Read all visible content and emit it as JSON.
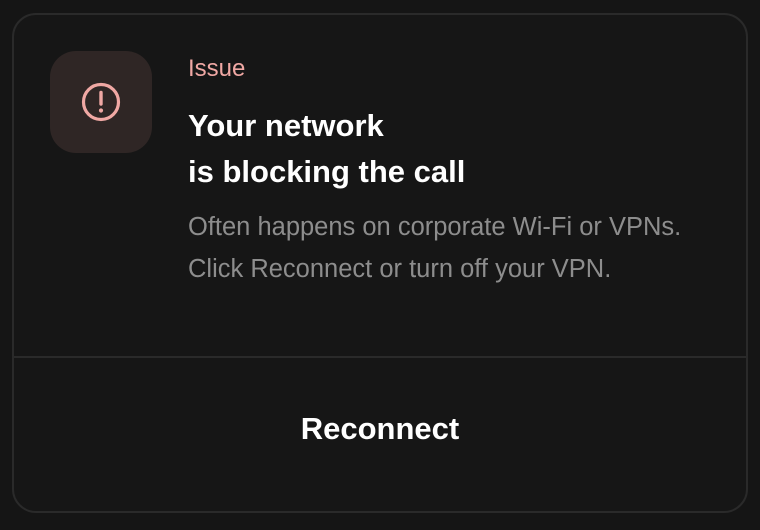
{
  "dialog": {
    "eyebrow": "Issue",
    "title_line1": "Your network",
    "title_line2": "is blocking the call",
    "description": "Often happens on corporate Wi-Fi or VPNs. Click Reconnect or turn off your VPN.",
    "icon": "alert-circle-icon",
    "action_label": "Reconnect"
  },
  "colors": {
    "accent": "#f0a8a4",
    "icon_tile_bg": "#2f2625",
    "card_bg": "#161616",
    "border": "#2a2a2a",
    "text_primary": "#ffffff",
    "text_secondary": "#8d8d8d"
  }
}
